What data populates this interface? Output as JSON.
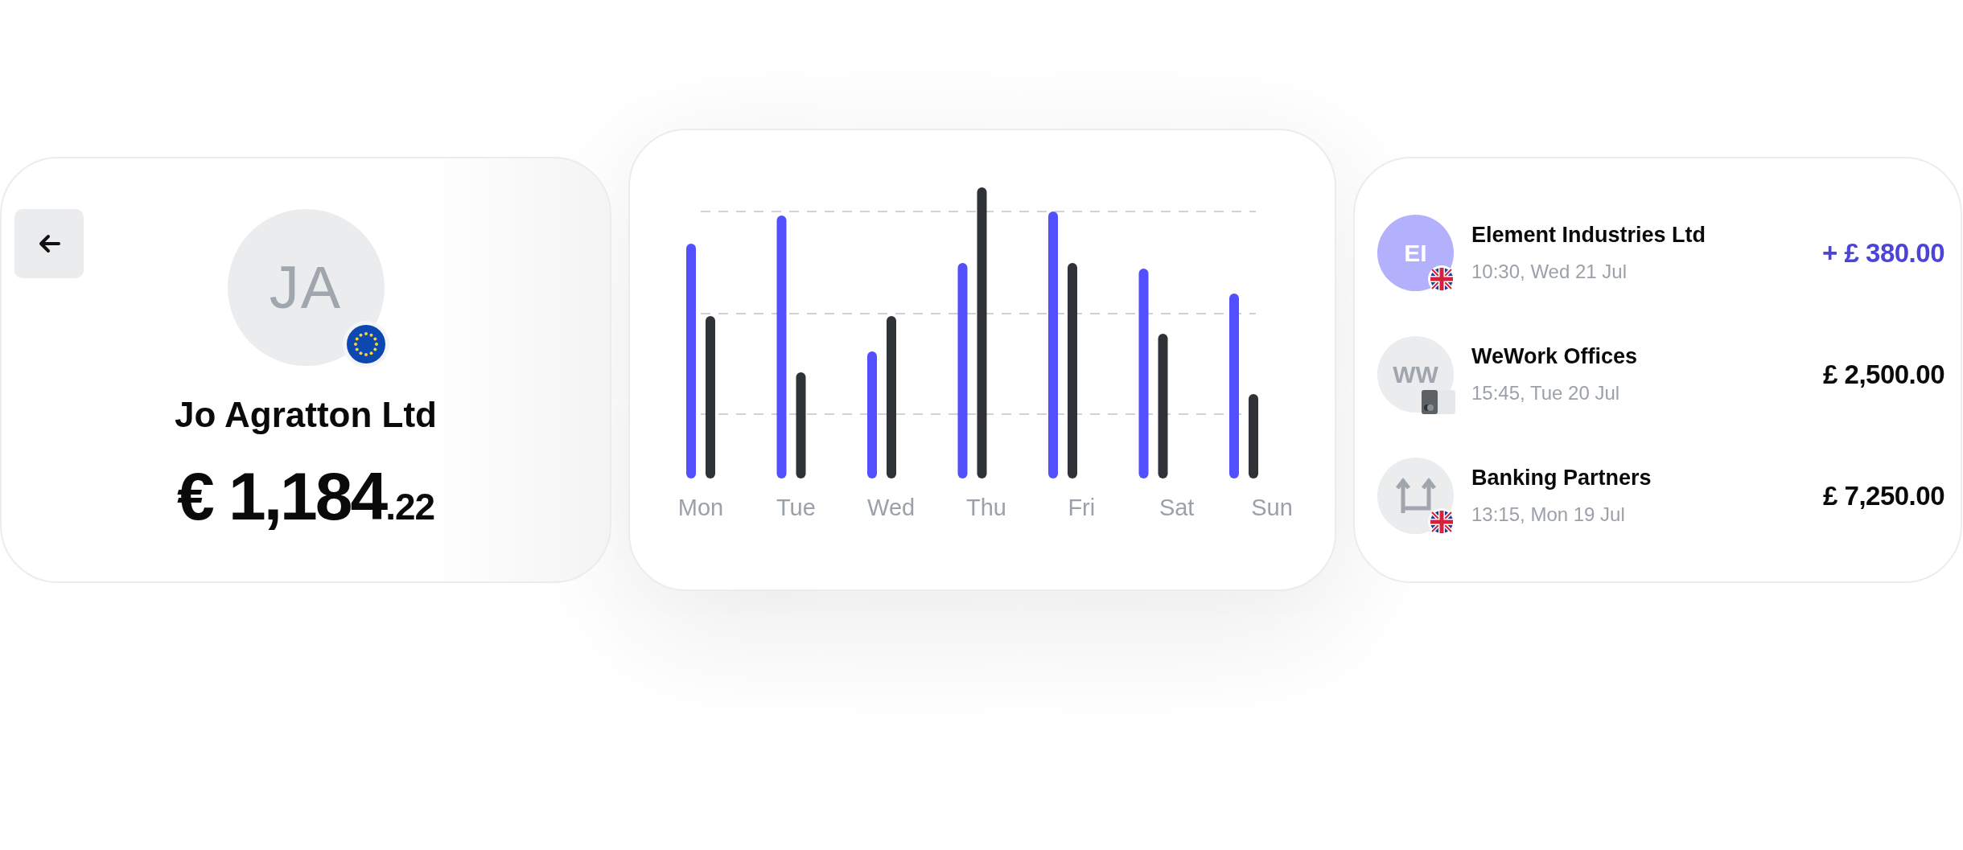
{
  "account": {
    "initials": "JA",
    "name": "Jo Agratton Ltd",
    "balance_main": "€ 1,184",
    "balance_fraction": ".22"
  },
  "chart": {
    "days": [
      "Mon",
      "Tue",
      "Wed",
      "Thu",
      "Fri",
      "Sat",
      "Sun"
    ]
  },
  "transactions": [
    {
      "kind": "initials",
      "initials": "EI",
      "badge": {
        "kind": "uk-flag"
      },
      "incoming": true,
      "name": "Element Industries Ltd",
      "time": "10:30, Wed 21 Jul",
      "amount": "+ £ 380.00"
    },
    {
      "kind": "initials",
      "initials": "WW",
      "badge": {
        "kind": "card"
      },
      "incoming": false,
      "name": "WeWork Offices",
      "time": "15:45, Tue 20 Jul",
      "amount": "£ 2,500.00"
    },
    {
      "kind": "transfer",
      "badge": {
        "kind": "uk-flag"
      },
      "incoming": false,
      "name": "Banking Partners",
      "time": "13:15, Mon 19 Jul",
      "amount": "£ 7,250.00"
    }
  ]
}
